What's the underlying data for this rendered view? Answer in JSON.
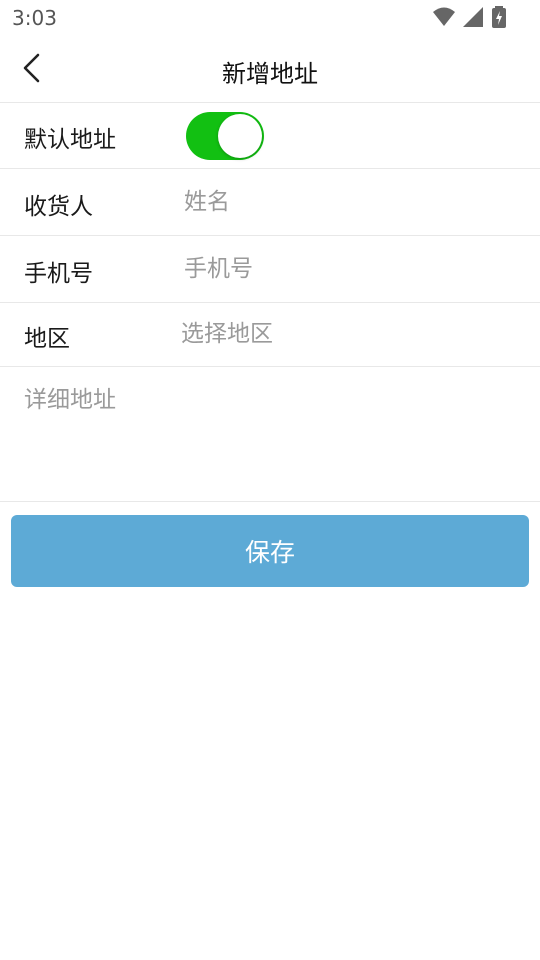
{
  "status_bar": {
    "time": "3:03",
    "icons": [
      "wifi-icon",
      "signal-icon",
      "battery-charging-icon"
    ]
  },
  "header": {
    "back_icon": "chevron-left-icon",
    "title": "新增地址"
  },
  "form": {
    "default_address": {
      "label": "默认地址",
      "enabled": true
    },
    "recipient": {
      "label": "收货人",
      "placeholder": "姓名",
      "value": ""
    },
    "phone": {
      "label": "手机号",
      "placeholder": "手机号",
      "value": ""
    },
    "region": {
      "label": "地区",
      "placeholder": "选择地区",
      "value": ""
    },
    "detail": {
      "placeholder": "详细地址",
      "value": ""
    }
  },
  "actions": {
    "save_label": "保存"
  },
  "colors": {
    "toggle_on": "#12c012",
    "save_button": "#5daad6",
    "divider": "#e8e8e8",
    "placeholder": "#9a9a9a"
  }
}
